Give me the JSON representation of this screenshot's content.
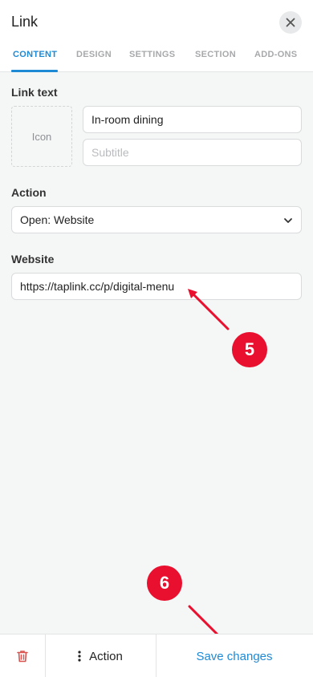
{
  "header": {
    "title": "Link",
    "close_icon": "close-icon"
  },
  "tabs": [
    {
      "label": "CONTENT",
      "active": true
    },
    {
      "label": "DESIGN",
      "active": false
    },
    {
      "label": "SETTINGS",
      "active": false
    },
    {
      "label": "SECTION",
      "active": false
    },
    {
      "label": "ADD-ONS",
      "active": false
    }
  ],
  "link_text": {
    "label": "Link text",
    "icon_placeholder": "Icon",
    "title_value": "In-room dining",
    "subtitle_placeholder": "Subtitle"
  },
  "action": {
    "label": "Action",
    "selected": "Open: Website"
  },
  "website": {
    "label": "Website",
    "value": "https://taplink.cc/p/digital-menu"
  },
  "footer": {
    "delete_icon": "trash-icon",
    "action_label": "Action",
    "save_label": "Save changes"
  },
  "annotations": [
    {
      "number": "5"
    },
    {
      "number": "6"
    }
  ],
  "colors": {
    "accent": "#1e8ad6",
    "delete": "#d9534f",
    "annotation": "#e8102e"
  }
}
